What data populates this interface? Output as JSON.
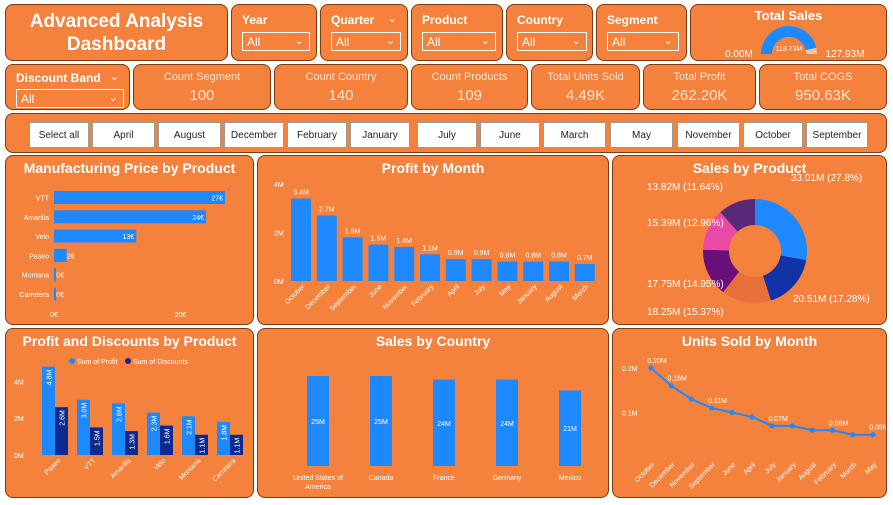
{
  "dashboard_title": "Advanced Analysis Dashboard",
  "colors": {
    "panel": "#F4823C",
    "bar": "#1E88FF",
    "bar_dark": "#0D2B8F",
    "text": "#ffffff"
  },
  "slicers": {
    "year": {
      "label": "Year",
      "value": "All"
    },
    "quarter": {
      "label": "Quarter",
      "value": "All"
    },
    "product": {
      "label": "Product",
      "value": "All"
    },
    "country": {
      "label": "Country",
      "value": "All"
    },
    "segment": {
      "label": "Segment",
      "value": "All"
    },
    "discount_band": {
      "label": "Discount Band",
      "value": "All"
    }
  },
  "total_sales": {
    "label": "Total Sales",
    "min": "0.00M",
    "value": "118.73M",
    "max": "127.93M",
    "fraction": 0.928
  },
  "kpis": {
    "count_segment": {
      "label": "Count Segment",
      "value": "100"
    },
    "count_country": {
      "label": "Count Country",
      "value": "140"
    },
    "count_products": {
      "label": "Count Products",
      "value": "109"
    },
    "total_units_sold": {
      "label": "Total Units Sold",
      "value": "4.49K"
    },
    "total_profit": {
      "label": "Total Profit",
      "value": "262.20K"
    },
    "total_cogs": {
      "label": "Total COGS",
      "value": "950.63K"
    }
  },
  "month_buttons": [
    "Select all",
    "April",
    "August",
    "December",
    "February",
    "January",
    "July",
    "June",
    "March",
    "May",
    "November",
    "October",
    "September"
  ],
  "chart_data": [
    {
      "type": "bar",
      "orientation": "horizontal",
      "title": "Manufacturing Price by Product",
      "categories": [
        "VTT",
        "Amarilla",
        "Velo",
        "Paseo",
        "Montana",
        "Carretera"
      ],
      "values": [
        27,
        24,
        13,
        2,
        0,
        0
      ],
      "data_labels": [
        "27€",
        "24€",
        "13€",
        "2€",
        "0€",
        "0€"
      ],
      "x_ticks": [
        "0€",
        "20€"
      ],
      "xlim": [
        0,
        30
      ]
    },
    {
      "type": "bar",
      "title": "Profit by Month",
      "categories": [
        "October",
        "December",
        "September",
        "June",
        "November",
        "February",
        "April",
        "July",
        "May",
        "January",
        "August",
        "March"
      ],
      "values": [
        3.4,
        2.7,
        1.8,
        1.5,
        1.4,
        1.1,
        0.9,
        0.9,
        0.8,
        0.8,
        0.8,
        0.7
      ],
      "data_labels": [
        "3.4M",
        "2.7M",
        "1.8M",
        "1.5M",
        "1.4M",
        "1.1M",
        "0.9M",
        "0.9M",
        "0.8M",
        "0.8M",
        "0.8M",
        "0.7M"
      ],
      "y_ticks": [
        "0M",
        "2M",
        "4M"
      ],
      "ylim": [
        0,
        4
      ]
    },
    {
      "type": "pie",
      "title": "Sales by Product",
      "slices": [
        {
          "label": "33.01M (27.8%)",
          "value": 33.01,
          "color": "#1E88FF"
        },
        {
          "label": "20.51M (17.28%)",
          "value": 20.51,
          "color": "#1233A8"
        },
        {
          "label": "18.25M (15.37%)",
          "value": 18.25,
          "color": "#E8703A"
        },
        {
          "label": "17.75M (14.95%)",
          "value": 17.75,
          "color": "#6A0F7A"
        },
        {
          "label": "15.39M (12.96%)",
          "value": 15.39,
          "color": "#E84AA4"
        },
        {
          "label": "13.82M (11.64%)",
          "value": 13.82,
          "color": "#5A2A7A"
        }
      ]
    },
    {
      "type": "bar",
      "title": "Profit and Discounts by Product",
      "categories": [
        "Paseo",
        "VTT",
        "Amarilla",
        "Velo",
        "Montana",
        "Carretera"
      ],
      "series": [
        {
          "name": "Sum of Profit",
          "color": "#1E88FF",
          "values": [
            4.8,
            3.0,
            2.8,
            2.3,
            2.1,
            1.8
          ],
          "data_labels": [
            "4.8M",
            "3.0M",
            "2.8M",
            "2.3M",
            "2.1M",
            "1.8M"
          ]
        },
        {
          "name": "Sum of Discounts",
          "color": "#0D2B8F",
          "values": [
            2.6,
            1.5,
            1.3,
            1.6,
            1.1,
            1.1
          ],
          "data_labels": [
            "2.6M",
            "1.5M",
            "1.3M",
            "1.6M",
            "1.1M",
            "1.1M"
          ]
        }
      ],
      "y_ticks": [
        "0M",
        "2M",
        "4M"
      ],
      "ylim": [
        0,
        5
      ]
    },
    {
      "type": "bar",
      "title": "Sales by Country",
      "categories": [
        "United States of America",
        "Canada",
        "France",
        "Germany",
        "Mexico"
      ],
      "values": [
        25,
        25,
        24,
        24,
        21
      ],
      "data_labels": [
        "25M",
        "25M",
        "24M",
        "24M",
        "21M"
      ]
    },
    {
      "type": "line",
      "title": "Units Sold by Month",
      "categories": [
        "October",
        "December",
        "November",
        "September",
        "June",
        "April",
        "July",
        "January",
        "August",
        "February",
        "March",
        "May"
      ],
      "values": [
        0.2,
        0.16,
        0.13,
        0.11,
        0.1,
        0.09,
        0.07,
        0.07,
        0.06,
        0.06,
        0.05,
        0.05
      ],
      "data_labels": [
        "0.20M",
        "0.16M",
        "",
        "0.11M",
        "",
        "",
        "0.07M",
        "",
        "",
        "0.06M",
        "",
        "0.05M"
      ],
      "y_ticks": [
        "0.1M",
        "0.2M"
      ],
      "ylim": [
        0,
        0.22
      ]
    }
  ]
}
